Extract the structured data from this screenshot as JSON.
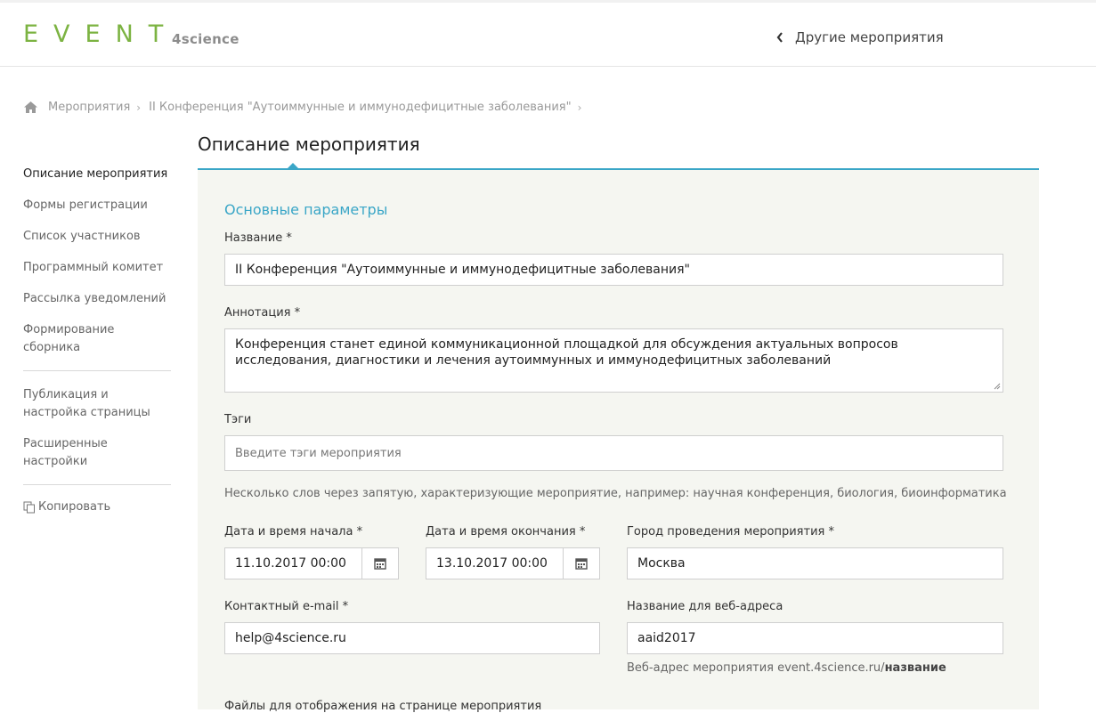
{
  "header": {
    "logo_main": "EVENT",
    "logo_sub": "4science",
    "other_events": "Другие мероприятия"
  },
  "breadcrumb": {
    "items": [
      "Мероприятия",
      "II Конференция \"Аутоиммунные и иммунодефицитные заболевания\""
    ]
  },
  "sidebar": {
    "items": [
      "Описание мероприятия",
      "Формы регистрации",
      "Список участников",
      "Программный комитет",
      "Рассылка уведомлений",
      "Формирование сборника"
    ],
    "items2": [
      "Публикация и настройка страницы",
      "Расширенные настройки"
    ],
    "copy": "Копировать"
  },
  "main": {
    "title": "Описание мероприятия",
    "section_title": "Основные параметры",
    "name_label": "Название *",
    "name_value": "II Конференция \"Аутоиммунные и иммунодефицитные заболевания\"",
    "annotation_label": "Аннотация *",
    "annotation_value": "Конференция станет единой коммуникационной площадкой для обсуждения актуальных вопросов исследования, диагностики и лечения аутоиммунных и иммунодефицитных заболеваний",
    "tags_label": "Тэги",
    "tags_placeholder": "Введите тэги мероприятия",
    "tags_hint": "Несколько слов через запятую, характеризующие мероприятие, например: научная конференция, биология, биоинформатика",
    "start_label": "Дата и время начала *",
    "start_value": "11.10.2017 00:00",
    "end_label": "Дата и время окончания *",
    "end_value": "13.10.2017 00:00",
    "city_label": "Город проведения мероприятия *",
    "city_value": "Москва",
    "email_label": "Контактный e-mail *",
    "email_value": "help@4science.ru",
    "slug_label": "Название для веб-адреса",
    "slug_value": "aaid2017",
    "slug_hint_prefix": "Веб-адрес мероприятия event.4science.ru/",
    "slug_hint_bold": "название",
    "files_label": "Файлы для отображения на странице мероприятия"
  },
  "colors": {
    "brand_green": "#7cb342",
    "accent_blue": "#3aa6c7",
    "panel_bg": "#f5f6f1"
  }
}
